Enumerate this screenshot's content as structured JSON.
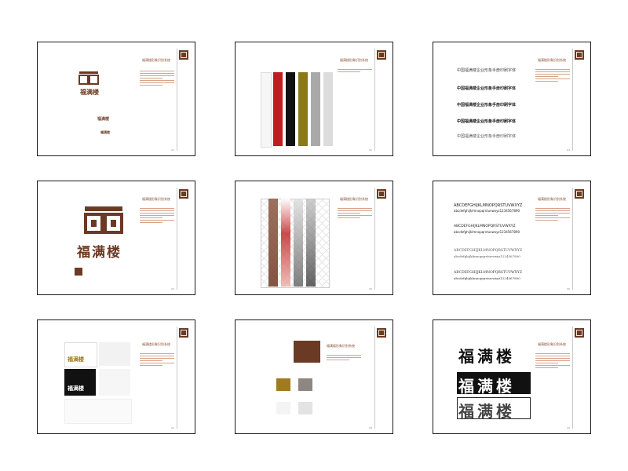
{
  "pages": [
    {
      "id": "p1",
      "title": "福满楼形象识别系统",
      "logo_text": "福满楼"
    },
    {
      "id": "p2",
      "title": "福满楼形象识别系统"
    },
    {
      "id": "p3",
      "title": "福满楼形象识别系统",
      "font_lines": [
        "中国福满楼企业形象手册印刷字体",
        "中国福满楼企业形象手册印刷字体",
        "中国福满楼企业形象手册印刷字体",
        "中国福满楼企业形象手册印刷字体",
        "中国福满楼企业形象手册印刷字体"
      ]
    },
    {
      "id": "p4",
      "title": "福满楼形象识别系统",
      "logo_text": "福满楼"
    },
    {
      "id": "p5",
      "title": "福满楼形象识别系统"
    },
    {
      "id": "p6",
      "title": "福满楼形象识别系统",
      "alphabet_lines": [
        "ABCDEFGHIJKLMNOPQRSTUVWXYZ",
        "abcdefghijklmnopqrstuvwxyz1234567890",
        "ABCDEFGHIJKLMNOPQRSTUVWXYZ",
        "abcdefghijklmnopqrstuvwxyz1234567890",
        "ABCDEFGHIJKLMNOPQRSTUVWXYZ",
        "abcdefghijklmnopqrstuvwxyz1234567890",
        "ABCDEFGHIJKLMNOPQRSTUVWXYZ",
        "abcdefghijklmnopqrstuvwxyz1234567890"
      ]
    },
    {
      "id": "p7",
      "title": "福满楼形象识别系统",
      "logo_text": "福满楼"
    },
    {
      "id": "p8",
      "title": "福满楼形象识别系统"
    },
    {
      "id": "p9",
      "title": "福满楼形象识别系统",
      "logo_text": "福满楼"
    }
  ],
  "colors": {
    "brand": "#6b3a24",
    "gold": "#a07a1e",
    "red": "#c01d20",
    "olive": "#8b7a14",
    "gray": "#9a9a9a",
    "light": "#d6d6d6"
  }
}
